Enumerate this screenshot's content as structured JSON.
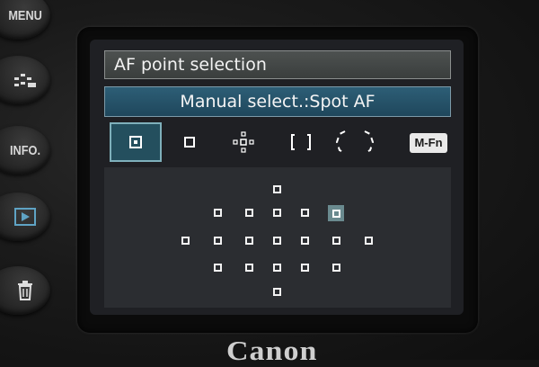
{
  "buttons": {
    "menu": "MENU",
    "info": "INFO."
  },
  "screen": {
    "title": "AF point selection",
    "mode": "Manual select.:Spot AF",
    "mfn": "M-Fn"
  },
  "af_modes": [
    {
      "icon": "spot-af-icon",
      "selected": true
    },
    {
      "icon": "single-point-af-icon",
      "selected": false
    },
    {
      "icon": "expansion-af-icon",
      "selected": false
    },
    {
      "icon": "zone-af-icon",
      "selected": false
    },
    {
      "icon": "large-zone-af-icon",
      "selected": false
    }
  ],
  "selected_af_point": "row 2, position 5",
  "brand": "Canon",
  "colors": {
    "title_bar": "#44484a",
    "mode_bar": "#265469",
    "selection_highlight": "#244f5e",
    "af_area": "#2b2d31"
  }
}
